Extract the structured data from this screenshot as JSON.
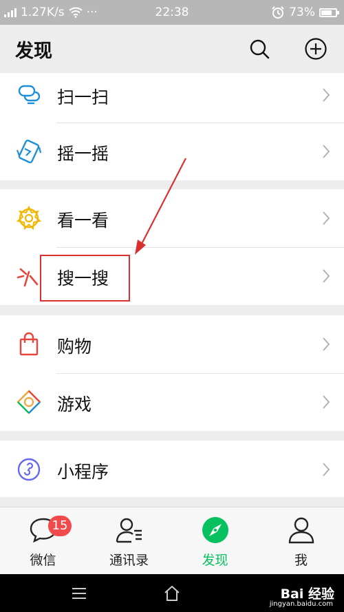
{
  "status_bar": {
    "speed": "1.27K/s",
    "dots": "···",
    "time": "22:38",
    "battery": "73%",
    "battery_level": 0.73
  },
  "header": {
    "title": "发现",
    "search_icon": "search-icon",
    "add_icon": "plus-circle-icon"
  },
  "groups": [
    {
      "items": [
        {
          "label": "扫一扫",
          "icon": "scan-icon"
        },
        {
          "label": "摇一摇",
          "icon": "shake-icon"
        }
      ]
    },
    {
      "items": [
        {
          "label": "看一看",
          "icon": "top-stories-icon"
        },
        {
          "label": "搜一搜",
          "icon": "search-spark-icon"
        }
      ]
    },
    {
      "items": [
        {
          "label": "购物",
          "icon": "shopping-bag-icon"
        },
        {
          "label": "游戏",
          "icon": "games-icon"
        }
      ]
    },
    {
      "items": [
        {
          "label": "小程序",
          "icon": "mini-programs-icon"
        }
      ]
    }
  ],
  "tabs": [
    {
      "label": "微信",
      "icon": "chat-icon",
      "badge": "15"
    },
    {
      "label": "通讯录",
      "icon": "contacts-icon"
    },
    {
      "label": "发现",
      "icon": "compass-icon",
      "active": true
    },
    {
      "label": "我",
      "icon": "person-icon"
    }
  ],
  "watermark": {
    "text": "Bai 经验",
    "sub": "jingyan.baidu.com"
  },
  "colors": {
    "accent": "#07c160",
    "annotation": "#d9302f",
    "badge": "#f04a4a"
  }
}
